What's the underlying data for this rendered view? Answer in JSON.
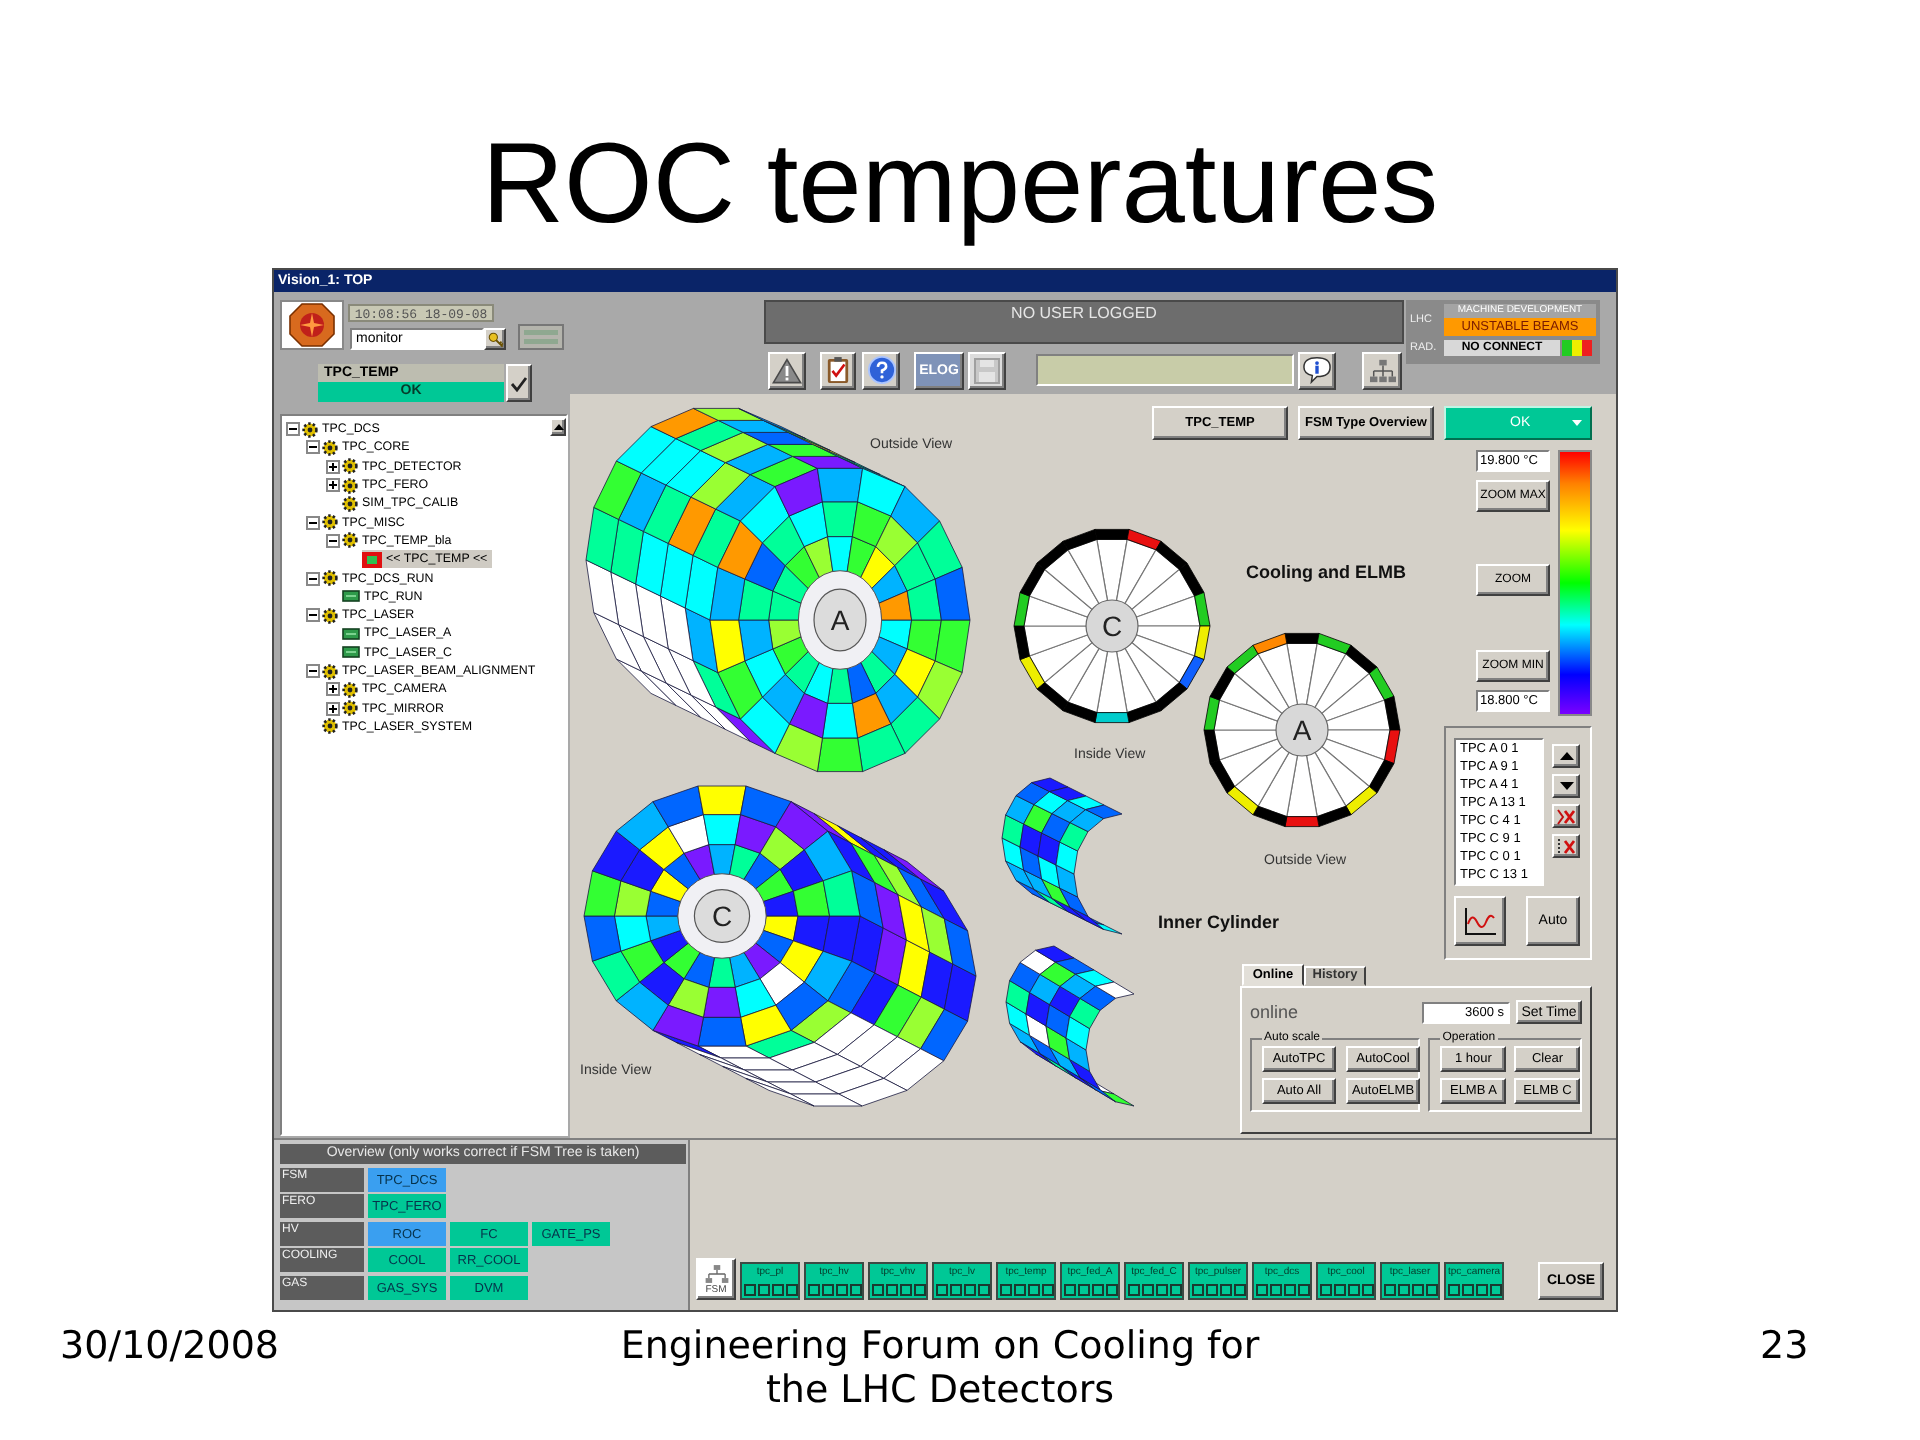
{
  "slide": {
    "title": "ROC temperatures",
    "date": "30/10/2008",
    "footer": "Engineering Forum on Cooling for the LHC Detectors",
    "page_number": "23"
  },
  "window": {
    "title": "Vision_1: TOP"
  },
  "session": {
    "time": "10:08:56 18-09-08",
    "user": "monitor",
    "node": "TPC_TEMP",
    "node_state": "OK"
  },
  "tree": [
    {
      "label": "TPC_DCS",
      "kind": "node",
      "expanded": true,
      "selected": false,
      "children": [
        {
          "label": "TPC_CORE",
          "kind": "node",
          "expanded": true,
          "selected": false,
          "children": [
            {
              "label": "TPC_DETECTOR",
              "kind": "node",
              "expanded": false,
              "selected": false
            },
            {
              "label": "TPC_FERO",
              "kind": "node",
              "expanded": false,
              "selected": false
            },
            {
              "label": "SIM_TPC_CALIB",
              "kind": "node",
              "selected": false
            }
          ]
        },
        {
          "label": "TPC_MISC",
          "kind": "node",
          "expanded": true,
          "selected": false,
          "children": [
            {
              "label": "TPC_TEMP_bla",
              "kind": "node",
              "expanded": true,
              "selected": false,
              "children": [
                {
                  "label": "<< TPC_TEMP <<",
                  "kind": "current",
                  "selected": true
                }
              ]
            }
          ]
        },
        {
          "label": "TPC_DCS_RUN",
          "kind": "node",
          "expanded": true,
          "selected": false,
          "children": [
            {
              "label": "TPC_RUN",
              "kind": "device",
              "selected": false
            }
          ]
        },
        {
          "label": "TPC_LASER",
          "kind": "node",
          "expanded": true,
          "selected": false,
          "children": [
            {
              "label": "TPC_LASER_A",
              "kind": "device",
              "selected": false
            },
            {
              "label": "TPC_LASER_C",
              "kind": "device",
              "selected": false
            }
          ]
        },
        {
          "label": "TPC_LASER_BEAM_ALIGNMENT",
          "kind": "node",
          "expanded": true,
          "selected": false,
          "children": [
            {
              "label": "TPC_CAMERA",
              "kind": "node",
              "expanded": false,
              "selected": false
            },
            {
              "label": "TPC_MIRROR",
              "kind": "node",
              "expanded": false,
              "selected": false
            }
          ]
        },
        {
          "label": "TPC_LASER_SYSTEM",
          "kind": "node",
          "selected": false
        }
      ]
    }
  ],
  "top_bar": {
    "user_status": "NO USER LOGGED",
    "elog": "ELOG",
    "save": {
      "disabled": true
    }
  },
  "lhc": {
    "label": "LHC",
    "mode": "MACHINE DEVELOPMENT",
    "beam": "UNSTABLE BEAMS",
    "rad_label": "RAD.",
    "rad_status": "NO CONNECT"
  },
  "view_buttons": [
    "TPC_TEMP",
    "FSM Type Overview"
  ],
  "state_menu": "OK",
  "scale": {
    "max": "19.800 °C",
    "zoom_max": "ZOOM MAX",
    "zoom": "ZOOM",
    "zoom_min": "ZOOM MIN",
    "min": "18.800 °C"
  },
  "channels": {
    "items": [
      {
        "label": "TPC A 0 1",
        "selected": false
      },
      {
        "label": "TPC A 9 1",
        "selected": false
      },
      {
        "label": "TPC A 4 1",
        "selected": false
      },
      {
        "label": "TPC A 13 1",
        "selected": false
      },
      {
        "label": "TPC C 4 1",
        "selected": false
      },
      {
        "label": "TPC C 9 1",
        "selected": false
      },
      {
        "label": "TPC C 0 1",
        "selected": false
      },
      {
        "label": "TPC C 13 1",
        "selected": false
      }
    ],
    "auto": "Auto"
  },
  "cylinders": [
    {
      "hub": "A",
      "caption": "Outside View"
    },
    {
      "hub": "C",
      "caption": "Inside View"
    }
  ],
  "wheels": [
    {
      "hub": "C",
      "caption": "Inside View"
    },
    {
      "hub": "A",
      "caption": "Outside View"
    }
  ],
  "cooling_label": "Cooling and ELMB",
  "inner_label": "Inner Cylinder",
  "history": {
    "tabs": [
      {
        "label": "Online",
        "selected": true
      },
      {
        "label": "History",
        "selected": false
      }
    ],
    "mode": "online",
    "time_value": "3600 s",
    "set_time": "Set Time",
    "auto_scale": {
      "title": "Auto scale",
      "buttons": [
        "AutoTPC",
        "AutoCool",
        "Auto All",
        "AutoELMB"
      ]
    },
    "operation": {
      "title": "Operation",
      "buttons": [
        "1 hour",
        "Clear",
        "ELMB A",
        "ELMB C"
      ]
    }
  },
  "overview": {
    "title": "Overview (only works correct if FSM Tree is taken)",
    "rows": [
      {
        "label": "FSM",
        "cells": [
          {
            "text": "TPC_DCS",
            "color": "#3a9ff0"
          }
        ]
      },
      {
        "label": "FERO",
        "cells": [
          {
            "text": "TPC_FERO",
            "color": "#00c896"
          }
        ]
      },
      {
        "label": "HV",
        "cells": [
          {
            "text": "ROC",
            "color": "#3a9ff0"
          },
          {
            "text": "FC",
            "color": "#00c896"
          },
          {
            "text": "GATE_PS",
            "color": "#00c896"
          }
        ]
      },
      {
        "label": "COOLING",
        "cells": [
          {
            "text": "COOL",
            "color": "#00c896"
          },
          {
            "text": "RR_COOL",
            "color": "#00c896"
          }
        ]
      },
      {
        "label": "GAS",
        "cells": [
          {
            "text": "GAS_SYS",
            "color": "#00c896"
          },
          {
            "text": "DVM",
            "color": "#00c896"
          }
        ]
      }
    ]
  },
  "fsm": {
    "button": "FSM",
    "units": [
      "tpc_pl",
      "tpc_hv",
      "tpc_vhv",
      "tpc_lv",
      "tpc_temp",
      "tpc_fed_A",
      "tpc_fed_C",
      "tpc_pulser",
      "tpc_dcs",
      "tpc_cool",
      "tpc_laser",
      "tpc_camera"
    ]
  },
  "close": "CLOSE"
}
